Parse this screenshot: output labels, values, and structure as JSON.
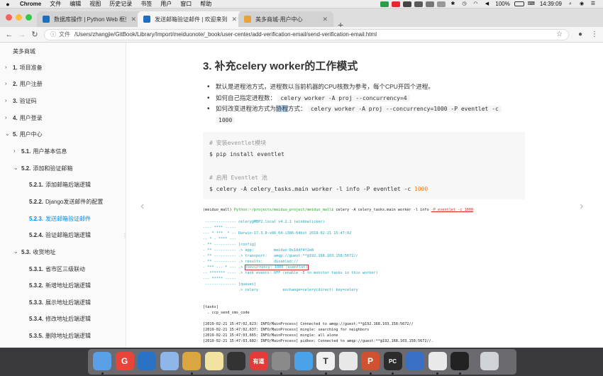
{
  "menubar": {
    "app": "Chrome",
    "menus": [
      "文件",
      "编辑",
      "视图",
      "历史记录",
      "书签",
      "用户",
      "窗口",
      "帮助"
    ],
    "battery": "100%",
    "time": "14:39:09"
  },
  "tabs": [
    {
      "title": "数据库操作 | Python Web 框架",
      "favicon_color": "#1f6fbf"
    },
    {
      "title": "发送邮箱验证邮件 | 欢迎来到美",
      "favicon_color": "#1f6fbf"
    },
    {
      "title": "美多商城-用户中心",
      "favicon_color": "#e8a23a"
    }
  ],
  "address": {
    "label": "文件",
    "url": "/Users/zhangjie/GitBook/Library/Import/meiduonote/_book/user-center/add-verification-email/send-verification-email.html"
  },
  "sidebar": {
    "title": "美多商城",
    "items": [
      {
        "num": "1.",
        "label": "项目准备"
      },
      {
        "num": "2.",
        "label": "用户注册"
      },
      {
        "num": "3.",
        "label": "验证码"
      },
      {
        "num": "4.",
        "label": "用户登录"
      },
      {
        "num": "5.",
        "label": "用户中心"
      },
      {
        "num": "5.1.",
        "label": "用户基本信息"
      },
      {
        "num": "5.2.",
        "label": "添加和验证邮箱"
      },
      {
        "num": "5.2.1.",
        "label": "添加邮箱后端逻辑"
      },
      {
        "num": "5.2.2.",
        "label": "Django发送邮件的配置"
      },
      {
        "num": "5.2.3.",
        "label": "发送邮箱验证邮件"
      },
      {
        "num": "5.2.4.",
        "label": "验证邮箱后端逻辑"
      },
      {
        "num": "5.3.",
        "label": "收货地址"
      },
      {
        "num": "5.3.1.",
        "label": "省市区三级联动"
      },
      {
        "num": "5.3.2.",
        "label": "新增地址后端逻辑"
      },
      {
        "num": "5.3.3.",
        "label": "展示地址后端逻辑"
      },
      {
        "num": "5.3.4.",
        "label": "修改地址后端逻辑"
      },
      {
        "num": "5.3.5.",
        "label": "删除地址后端逻辑"
      }
    ]
  },
  "content": {
    "heading": "3. 补充celery worker的工作模式",
    "bullet1": "默认是进程池方式，进程数以当前机器的CPU核数为参考，每个CPU开四个进程。",
    "bullet2_text": "如何自己指定进程数：",
    "bullet2_code": "celery worker -A proj --concurrency=4",
    "bullet3_pre": "如何改变进程池方式为",
    "bullet3_hl": "协程",
    "bullet3_post": "方式：",
    "bullet3_code": "celery worker -A proj --concurrency=1000 -P eventlet -c",
    "bullet3_code2": "1000",
    "code": {
      "comment1": "# 安装eventlet模块",
      "line1": "$ pip install eventlet",
      "comment2": "# 启用 Eventlet 池",
      "line2_pre": "$ celery -A celery_tasks.main worker -l info -P eventlet -c ",
      "line2_num": "1000"
    },
    "terminal": {
      "prompt_env": "(meiduo_mall) ",
      "prompt_host": "Python:~/projects/meiduo_project/meiduo_mall$",
      "prompt_cmd": " celery -A celery_tasks.main worker -l info ",
      "prompt_flag": "-P eventlet -c 1000",
      "banner": [
        " -------------- celery@MBP2.local v4.2.1 (windowlicker)",
        "---- **** -----",
        "--- * ***  * -- Darwin-17.3.0-x86_64-i386-64bit 2019-02-21 15:47:02",
        "-- * - **** ---",
        "- ** ---------- [config]",
        "- ** ---------- .> app:         meiduo:0x10df4f2e8",
        "- ** ---------- .> transport:   amqp://guest:**@192.168.103.158:5672//",
        "- ** ---------- .> results:     disabled://"
      ],
      "concurrency_pre": "- *** --- * --- .> ",
      "concurrency_box": "concurrency: 1000 (eventlet)",
      "banner2": [
        "-- ******* ---- .> task events: OFF (enable -E to monitor tasks in this worker)",
        "--- ***** -----",
        " -------------- [queues]",
        "                .> celery           exchange=celery(direct) key=celery"
      ],
      "tasks_header": "[tasks]",
      "tasks_item": "  . ccp_send_sms_code",
      "log": [
        "[2019-02-21 15:47:02,623: INFO/MainProcess] Connected to amqp://guest:**@192.168.103.158:5672//",
        "[2019-02-21 15:47:02,637: INFO/MainProcess] mingle: searching for neighbors",
        "[2019-02-21 15:47:03,665: INFO/MainProcess] mingle: all alone",
        "[2019-02-21 15:47:03,682: INFO/MainProcess] pidbox: Connected to amqp://guest:**@192.168.103.158:5672//."
      ]
    }
  },
  "dock": [
    {
      "name": "finder",
      "color": "#5aa0e6",
      "glyph": ""
    },
    {
      "name": "git",
      "color": "#e8443a",
      "glyph": "G"
    },
    {
      "name": "vscode",
      "color": "#2a72c4",
      "glyph": ""
    },
    {
      "name": "app",
      "color": "#8fb6e8",
      "glyph": ""
    },
    {
      "name": "app",
      "color": "#d9a640",
      "glyph": ""
    },
    {
      "name": "notes",
      "color": "#f3e3a0",
      "glyph": ""
    },
    {
      "name": "obs",
      "color": "#333333",
      "glyph": ""
    },
    {
      "name": "youdao",
      "color": "#e33a3a",
      "glyph": "有道"
    },
    {
      "name": "system-prefs",
      "color": "#8a8a8a",
      "glyph": ""
    },
    {
      "name": "safari",
      "color": "#4aa2e8",
      "glyph": ""
    },
    {
      "name": "typora",
      "color": "#f0f0f0",
      "glyph": "T"
    },
    {
      "name": "xmind",
      "color": "#e8e8e8",
      "glyph": ""
    },
    {
      "name": "powerpoint",
      "color": "#d0512f",
      "glyph": "P"
    },
    {
      "name": "pycharm",
      "color": "#2b2b2b",
      "glyph": "PC"
    },
    {
      "name": "app",
      "color": "#3a6fc6",
      "glyph": ""
    },
    {
      "name": "chrome",
      "color": "#e9e9e9",
      "glyph": ""
    },
    {
      "name": "terminal",
      "color": "#222222",
      "glyph": ""
    },
    {
      "name": "trash",
      "color": "#cfd3d8",
      "glyph": ""
    }
  ]
}
